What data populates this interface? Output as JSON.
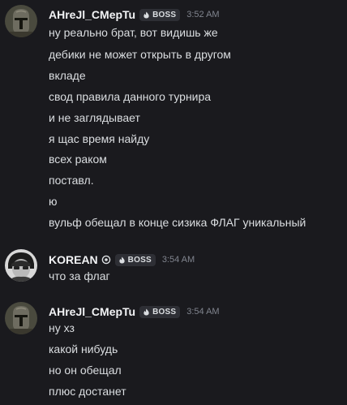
{
  "messages": [
    {
      "author": "AHreJl_CMepTu",
      "badge": "BOSS",
      "time": "3:52 AM",
      "avatar": "mandalorian-helmet",
      "lines": [
        "ну реально брат, вот видишь же",
        "дебики не может открыть в другом",
        "вкладе",
        "свод правила данного турнира",
        "и не заглядывает",
        "я щас время найду",
        "всех раком",
        "поставл.",
        "ю",
        "вульф обещал в конце сизика ФЛАГ уникальный"
      ]
    },
    {
      "author": "KOREAN",
      "badge": "BOSS",
      "time": "3:54 AM",
      "avatar": "grayscale-portrait",
      "lines": [
        "что за флаг"
      ]
    },
    {
      "author": "AHreJl_CMepTu",
      "badge": "BOSS",
      "time": "3:54 AM",
      "avatar": "mandalorian-helmet",
      "lines": [
        "ну хз",
        "какой нибудь",
        "но он обещал",
        "плюс достанет"
      ]
    }
  ],
  "colors": {
    "background": "#1a1a1e",
    "username": "#f2f3f5",
    "text": "#dbdee1",
    "timestamp": "#80848e",
    "badge_bg": "#2e2f35"
  }
}
